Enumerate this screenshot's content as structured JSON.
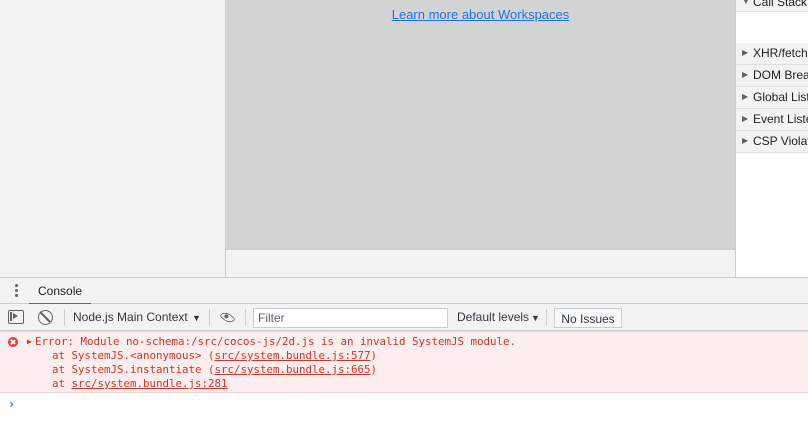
{
  "sources": {
    "workspace_link": "Learn more about Workspaces"
  },
  "debugger_sidebar": {
    "call_stack": "Call Stack",
    "panes": [
      "XHR/fetch Breakpoints",
      "DOM Breakpoints",
      "Global Listeners",
      "Event Listener Breakpoints",
      "CSP Violation Breakpoints"
    ]
  },
  "drawer": {
    "tab_label": "Console"
  },
  "toolbar": {
    "context": "Node.js Main Context",
    "filter_placeholder": "Filter",
    "levels": "Default levels",
    "issues": "No Issues"
  },
  "console": {
    "error": {
      "message": "Error: Module no-schema:/src/cocos-js/2d.js is an invalid SystemJS module.",
      "stack": [
        {
          "prefix": "at SystemJS.<anonymous> (",
          "link": "src/system.bundle.js:577",
          "suffix": ")"
        },
        {
          "prefix": "at SystemJS.instantiate (",
          "link": "src/system.bundle.js:665",
          "suffix": ")"
        },
        {
          "prefix": "at ",
          "link": "src/system.bundle.js:281",
          "suffix": ""
        }
      ]
    },
    "prompt": "›"
  },
  "colors": {
    "accent": "#1a73e8",
    "error_text": "#d93025",
    "error_background": "#fcedee",
    "editor_background": "#d3d3d3"
  },
  "icons": [
    "drawer-menu-icon",
    "sidebar-toggle-icon",
    "clear-console-icon",
    "eye-icon",
    "error-icon",
    "expand-triangle-icon"
  ]
}
